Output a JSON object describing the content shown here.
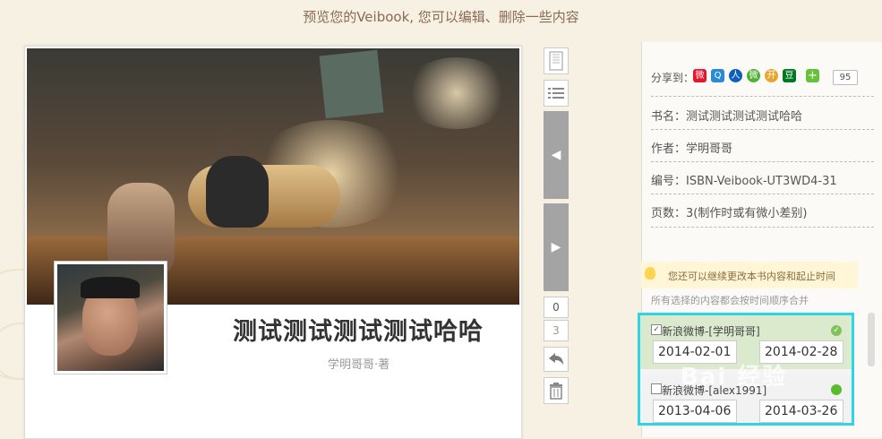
{
  "page": {
    "title": "预览您的Veibook, 您可以编辑、删除一些内容"
  },
  "book": {
    "title": "测试测试测试测试哈哈",
    "author_line": "学明哥哥·著"
  },
  "pager": {
    "current": "0",
    "total": "3"
  },
  "share": {
    "label": "分享到：",
    "count": "95",
    "icons": [
      "weibo-icon",
      "qzone-icon",
      "renren-icon",
      "wechat-icon",
      "kaixin-icon",
      "douban-icon",
      "plus-icon"
    ],
    "douban_char": "豆"
  },
  "info": {
    "name": "书名：测试测试测试测试哈哈",
    "author": "作者：学明哥哥",
    "isbn": "编号：ISBN-Veibook-UT3WD4-31",
    "pages": "页数：3(制作时或有微小差别)"
  },
  "tip": {
    "text": "您还可以继续更改本书内容和起止时间",
    "merge": "所有选择的内容都会按时间顺序合并"
  },
  "sources": [
    {
      "label": "新浪微博-[学明哥哥]",
      "checked": true,
      "start": "2014-02-01",
      "end": "2014-02-28"
    },
    {
      "label": "新浪微博-[alex1991]",
      "checked": false,
      "start": "2013-04-06",
      "end": "2014-03-26"
    }
  ],
  "watermark": "Bai 经验",
  "colors": {
    "highlight": "#2dd5e7",
    "active_source": "#dbeacd",
    "status_green": "#5bbb2b"
  }
}
